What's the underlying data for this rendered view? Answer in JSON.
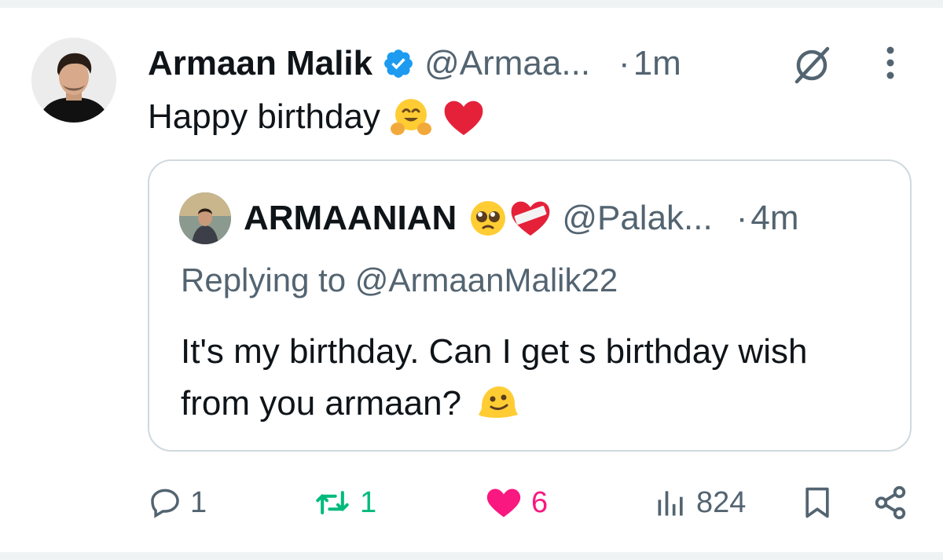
{
  "tweet": {
    "author_name": "Armaan Malik",
    "author_handle": "@Armaa...",
    "separator": "·",
    "time": "1m",
    "text": "Happy birthday",
    "emojis": [
      "hugging-face",
      "red-heart"
    ]
  },
  "quoted": {
    "author_name": "ARMAANIAN",
    "name_emojis": [
      "pleading-face",
      "mending-heart"
    ],
    "author_handle": "@Palak...",
    "separator": "·",
    "time": "4m",
    "replying_to": "Replying to @ArmaanMalik22",
    "body": "It's my birthday. Can I get s birthday wish from you armaan?",
    "body_emoji": "melting-face"
  },
  "actions": {
    "replies": "1",
    "reposts": "1",
    "likes": "6",
    "views": "824"
  },
  "colors": {
    "text": "#0f1419",
    "muted": "#536471",
    "verified": "#1d9bf0",
    "repost": "#00ba7c",
    "like": "#f91880",
    "border": "#cfd9de"
  }
}
